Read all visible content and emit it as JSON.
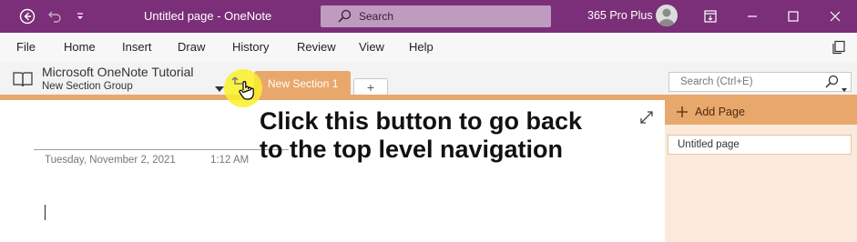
{
  "titlebar": {
    "title": "Untitled page  -  OneNote",
    "search_label": "Search",
    "account": "365 Pro Plus"
  },
  "menu": [
    "File",
    "Home",
    "Insert",
    "Draw",
    "History",
    "Review",
    "View",
    "Help"
  ],
  "navigation": {
    "notebook_title": "Microsoft OneNote Tutorial",
    "section_group": "New Section Group",
    "section_tab": "New Section 1",
    "add_tab_label": "+",
    "search_placeholder": "Search (Ctrl+E)"
  },
  "page": {
    "date": "Tuesday, November 2, 2021",
    "time": "1:12 AM",
    "annotation_line1": "Click this button to go back",
    "annotation_line2": "to the top level navigation"
  },
  "page_panel": {
    "add_page_label": "Add Page",
    "pages": [
      "Untitled page"
    ]
  },
  "colors": {
    "titlebar": "#7a2f78",
    "section_accent": "#e8a86b",
    "page_panel_bg": "#fbeadb"
  }
}
